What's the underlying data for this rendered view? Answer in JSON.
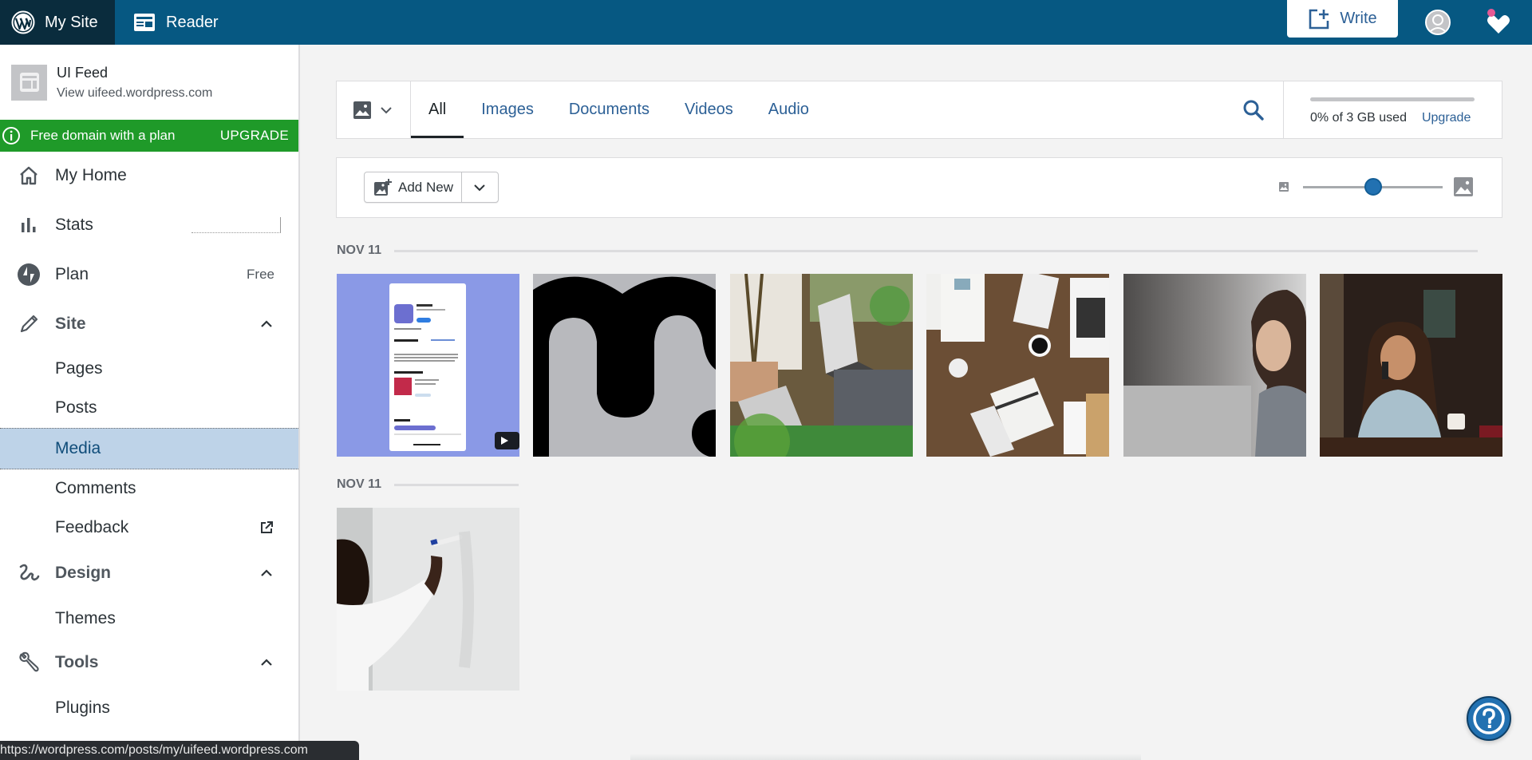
{
  "masterbar": {
    "my_site_label": "My Site",
    "reader_label": "Reader",
    "write_label": "Write",
    "colors": {
      "bar": "#065882",
      "my_site_active": "#0a2c3d",
      "notification_dot": "#e65995"
    }
  },
  "sidebar": {
    "site": {
      "title": "UI Feed",
      "url_label": "View uifeed.wordpress.com"
    },
    "promo": {
      "text": "Free domain with a plan",
      "cta": "UPGRADE",
      "color": "#1f9a29"
    },
    "items": [
      {
        "id": "my-home",
        "label": "My Home",
        "icon": "home-icon"
      },
      {
        "id": "stats",
        "label": "Stats",
        "icon": "stats-icon"
      },
      {
        "id": "plan",
        "label": "Plan",
        "icon": "plan-icon",
        "badge": "Free"
      },
      {
        "id": "site",
        "label": "Site",
        "icon": "pencil-icon",
        "expanded": true
      },
      {
        "id": "pages",
        "label": "Pages"
      },
      {
        "id": "posts",
        "label": "Posts"
      },
      {
        "id": "media",
        "label": "Media",
        "selected": true
      },
      {
        "id": "comments",
        "label": "Comments"
      },
      {
        "id": "feedback",
        "label": "Feedback",
        "icon": "external-link-icon"
      },
      {
        "id": "design",
        "label": "Design",
        "icon": "design-icon",
        "expanded": true
      },
      {
        "id": "themes",
        "label": "Themes"
      },
      {
        "id": "tools",
        "label": "Tools",
        "icon": "tools-icon",
        "expanded": true
      },
      {
        "id": "plugins",
        "label": "Plugins"
      }
    ]
  },
  "status_bar": {
    "url": "https://wordpress.com/posts/my/uifeed.wordpress.com"
  },
  "media": {
    "filter_tabs": [
      {
        "label": "All",
        "active": true
      },
      {
        "label": "Images",
        "active": false
      },
      {
        "label": "Documents",
        "active": false
      },
      {
        "label": "Videos",
        "active": false
      },
      {
        "label": "Audio",
        "active": false
      }
    ],
    "storage": {
      "used_percent": 0,
      "text": "0% of 3 GB used",
      "upgrade_label": "Upgrade"
    },
    "add_new_label": "Add New",
    "thumbnail_size_slider": {
      "value": 0.5
    },
    "groups": [
      {
        "date": "NOV 11",
        "items": [
          {
            "type": "video",
            "description": "Calory app store screenshot on purple background"
          },
          {
            "type": "image",
            "description": "Black 'm' logo on grey"
          },
          {
            "type": "image",
            "description": "People working at laptops outdoors"
          },
          {
            "type": "image",
            "description": "Desk flat-lay with newspaper, laptop and coffee"
          },
          {
            "type": "image",
            "description": "Woman in office looking to the side"
          },
          {
            "type": "image",
            "description": "Woman on phone in cafe"
          }
        ]
      },
      {
        "date": "NOV 11",
        "items": [
          {
            "type": "image",
            "description": "Person writing on whiteboard"
          }
        ]
      }
    ]
  },
  "help": {
    "label": "?"
  }
}
